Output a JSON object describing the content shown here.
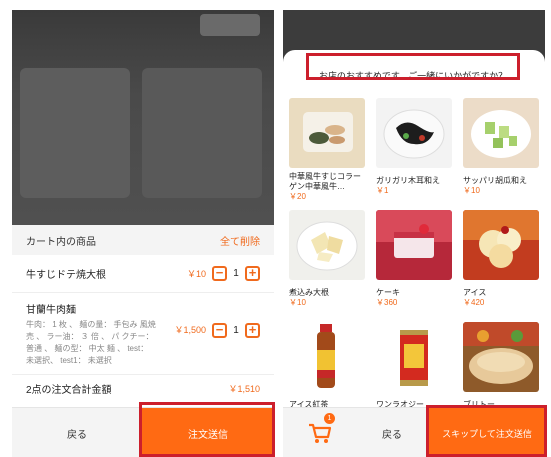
{
  "colors": {
    "accent": "#ff6a13",
    "highlight": "#cc1f2c",
    "price": "#f06a1d"
  },
  "left": {
    "cart_header": "カート内の商品",
    "clear_all": "全て削除",
    "items": [
      {
        "name": "牛すじドテ焼大根",
        "price": "￥10",
        "qty": "1"
      },
      {
        "name": "甘蘭牛肉麺",
        "desc": "牛肉： 1 枚 、 麺の量： 手包み 風焼売 、 ラー油： ３ 倍 、 パ クチー： 普通 、 麺の型： 中太 麺 、 test： 未選択、 test1： 未選択",
        "price": "￥1,500",
        "qty": "1"
      }
    ],
    "minus": "−",
    "plus": "+",
    "total_label": "2点の注文合計金額",
    "total_price": "￥1,510",
    "back": "戻る",
    "send": "注文送信"
  },
  "right": {
    "title": "お店のおすすめです、ご一緒にいかがですか？",
    "cards": [
      {
        "name": "中華風牛すじコラーゲン中華風牛…",
        "price": "￥20",
        "icon": "beef-dish-image"
      },
      {
        "name": "ガリガリ木耳和え",
        "price": "￥1",
        "icon": "wood-ear-image"
      },
      {
        "name": "サッパリ胡瓜和え",
        "price": "￥10",
        "icon": "cucumber-image"
      },
      {
        "name": "煮込み大根",
        "price": "￥10",
        "icon": "daikon-image"
      },
      {
        "name": "ケーキ",
        "price": "￥360",
        "icon": "cake-image"
      },
      {
        "name": "アイス",
        "price": "￥420",
        "icon": "ice-cream-image"
      },
      {
        "name": "アイス紅茶",
        "price": "",
        "icon": "tea-bottle-image"
      },
      {
        "name": "ワンラオジー",
        "price": "",
        "icon": "can-image"
      },
      {
        "name": "ブリトー",
        "price": "",
        "icon": "burrito-image"
      }
    ],
    "badge": "1",
    "back": "戻る",
    "skip": "スキップして注文送信"
  }
}
